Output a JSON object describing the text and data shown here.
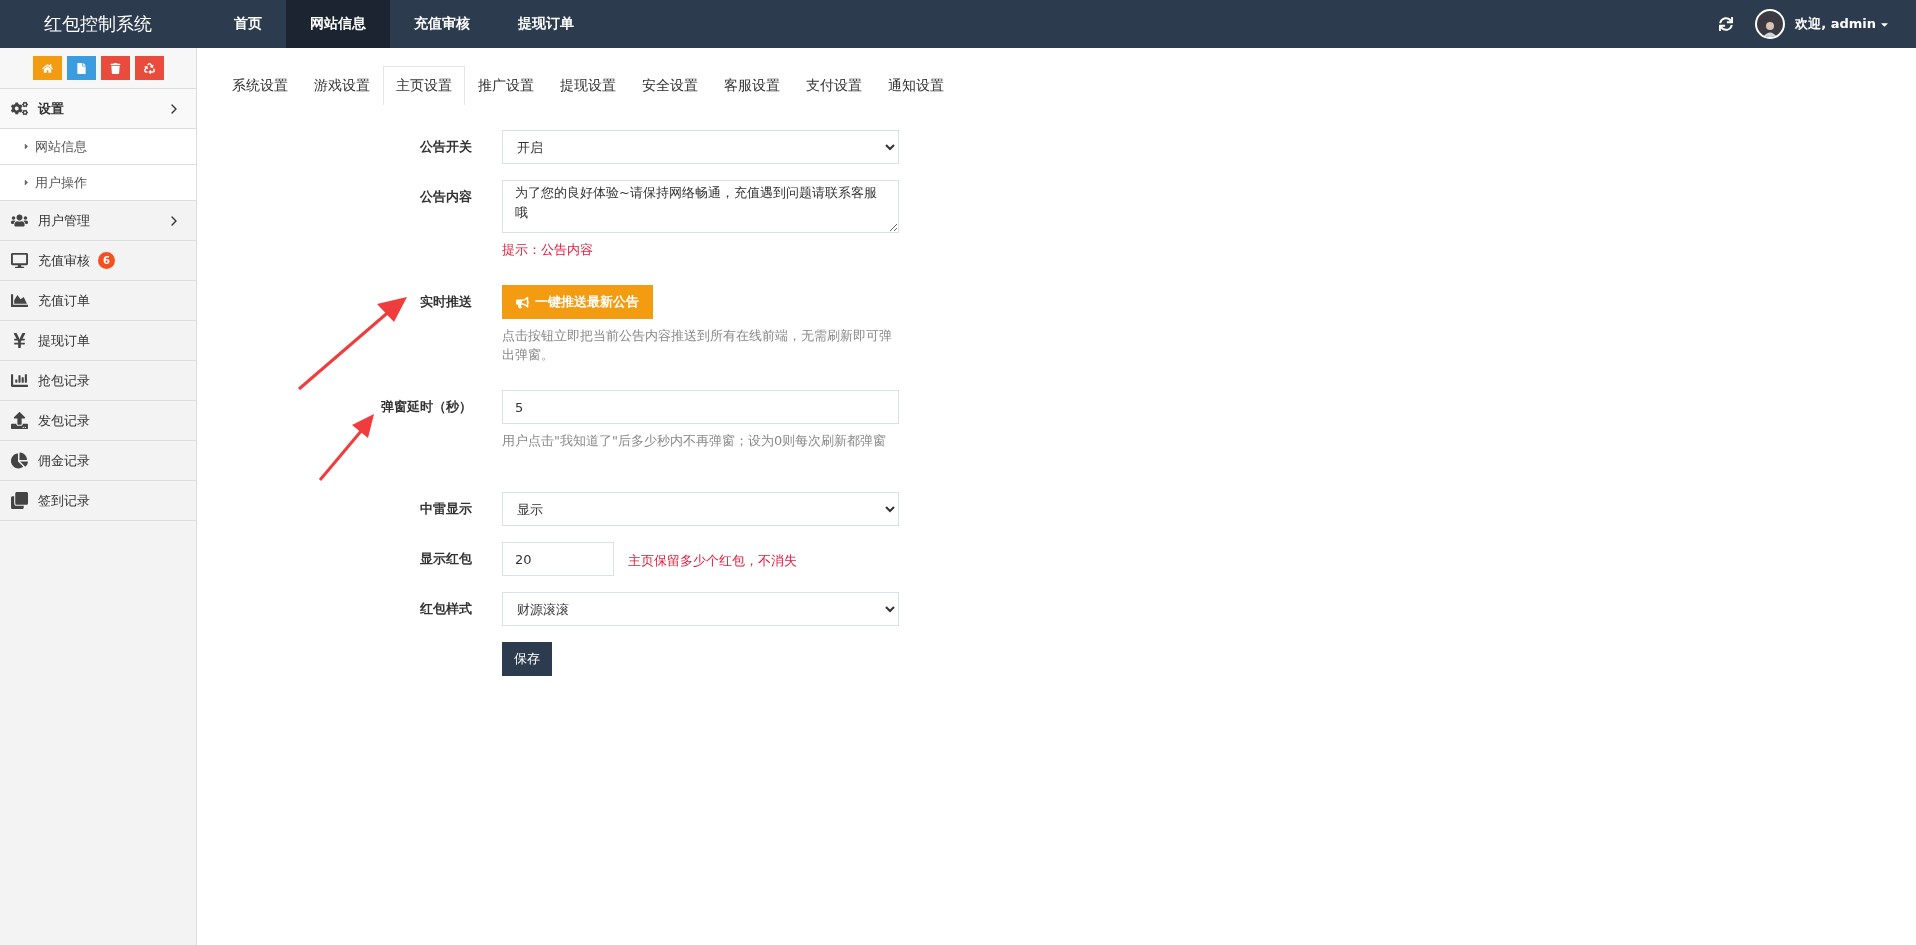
{
  "app": {
    "title": "红包控制系统"
  },
  "top_nav": [
    {
      "label": "首页",
      "selected": false
    },
    {
      "label": "网站信息",
      "selected": true
    },
    {
      "label": "充值审核",
      "selected": false
    },
    {
      "label": "提现订单",
      "selected": false
    }
  ],
  "user": {
    "greeting": "欢迎, admin"
  },
  "sidebar": {
    "quick_buttons": [
      {
        "kind": "home",
        "color": "#f39c12"
      },
      {
        "kind": "file",
        "color": "#3c9ce0"
      },
      {
        "kind": "trash",
        "color": "#e74c3c"
      },
      {
        "kind": "recycle",
        "color": "#e74c3c"
      }
    ],
    "items": [
      {
        "kind": "gears",
        "label": "设置",
        "expandable": true,
        "selected": true,
        "children": [
          {
            "label": "网站信息"
          },
          {
            "label": "用户操作"
          }
        ]
      },
      {
        "kind": "users",
        "label": "用户管理",
        "expandable": true,
        "selected": false
      },
      {
        "kind": "monitor",
        "label": "充值审核",
        "expandable": false,
        "selected": false,
        "badge": "6"
      },
      {
        "kind": "area",
        "label": "充值订单",
        "expandable": false,
        "selected": false
      },
      {
        "kind": "yen",
        "label": "提现订单",
        "expandable": false,
        "selected": false
      },
      {
        "kind": "bars",
        "label": "抢包记录",
        "expandable": false,
        "selected": false
      },
      {
        "kind": "upload",
        "label": "发包记录",
        "expandable": false,
        "selected": false
      },
      {
        "kind": "pie",
        "label": "佣金记录",
        "expandable": false,
        "selected": false
      },
      {
        "kind": "clone",
        "label": "签到记录",
        "expandable": false,
        "selected": false
      }
    ]
  },
  "tabs": [
    {
      "label": "系统设置",
      "selected": false
    },
    {
      "label": "游戏设置",
      "selected": false
    },
    {
      "label": "主页设置",
      "selected": true
    },
    {
      "label": "推广设置",
      "selected": false
    },
    {
      "label": "提现设置",
      "selected": false
    },
    {
      "label": "安全设置",
      "selected": false
    },
    {
      "label": "客服设置",
      "selected": false
    },
    {
      "label": "支付设置",
      "selected": false
    },
    {
      "label": "通知设置",
      "selected": false
    }
  ],
  "form": {
    "fields": [
      {
        "kind": "select",
        "label": "公告开关",
        "value": "开启"
      },
      {
        "kind": "textarea",
        "label": "公告内容",
        "value": "为了您的良好体验~请保持网络畅通，充值遇到问题请联系客服哦",
        "hint": {
          "kind": "alert",
          "text": "提示：公告内容"
        }
      },
      {
        "kind": "button",
        "label": "实时推送",
        "button": "一键推送最新公告",
        "hint": {
          "kind": "help",
          "text": "点击按钮立即把当前公告内容推送到所有在线前端，无需刷新即可弹出弹窗。"
        }
      },
      {
        "kind": "input",
        "label": "弹窗延时（秒）",
        "value": "5",
        "hint": {
          "kind": "help",
          "text": "用户点击\"我知道了\"后多少秒内不再弹窗；设为0则每次刷新都弹窗"
        }
      },
      {
        "kind": "select",
        "label": "中雷显示",
        "value": "显示"
      },
      {
        "kind": "short_input",
        "label": "显示红包",
        "value": "20",
        "hint": {
          "kind": "inline_alert",
          "text": "主页保留多少个红包，不消失"
        }
      },
      {
        "kind": "select",
        "label": "红包样式",
        "value": "财源滚滚"
      }
    ],
    "submit": "保存"
  }
}
